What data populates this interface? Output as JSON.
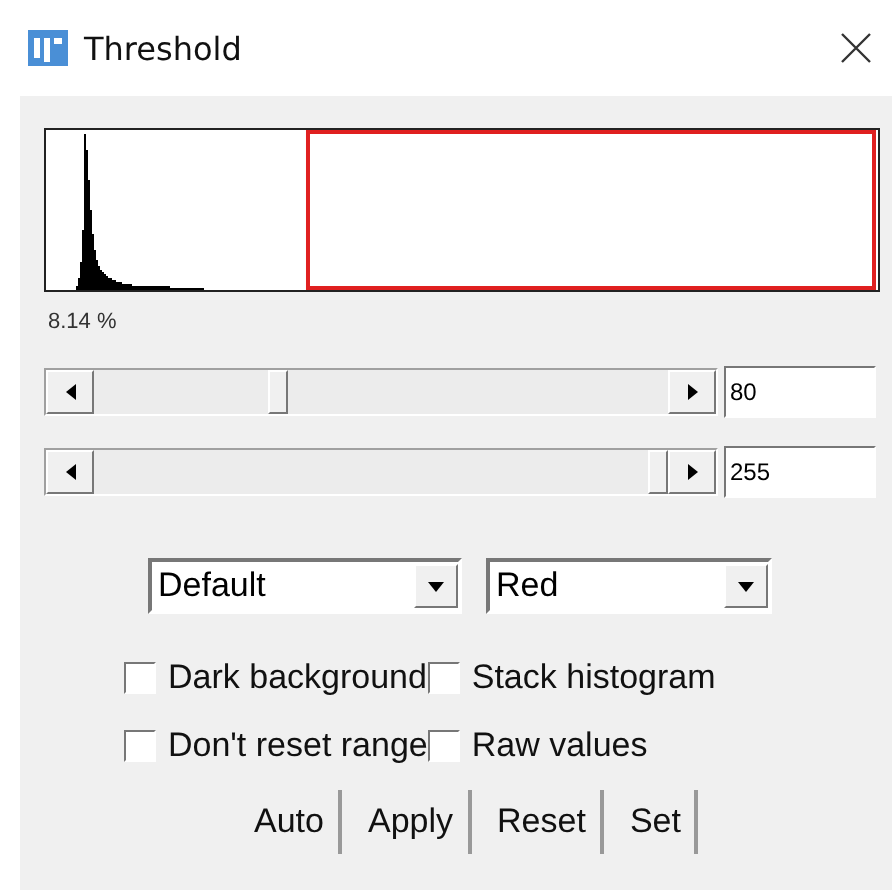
{
  "window": {
    "title": "Threshold"
  },
  "percentage": "8.14 %",
  "sliders": [
    {
      "value": "80"
    },
    {
      "value": "255"
    }
  ],
  "dropdowns": [
    {
      "value": "Default"
    },
    {
      "value": "Red"
    }
  ],
  "checkboxes": [
    {
      "label": "Dark background",
      "checked": false
    },
    {
      "label": "Stack histogram",
      "checked": false
    },
    {
      "label": "Don't reset range",
      "checked": false
    },
    {
      "label": "Raw values",
      "checked": false
    }
  ],
  "buttons": [
    "Auto",
    "Apply",
    "Reset",
    "Set"
  ]
}
